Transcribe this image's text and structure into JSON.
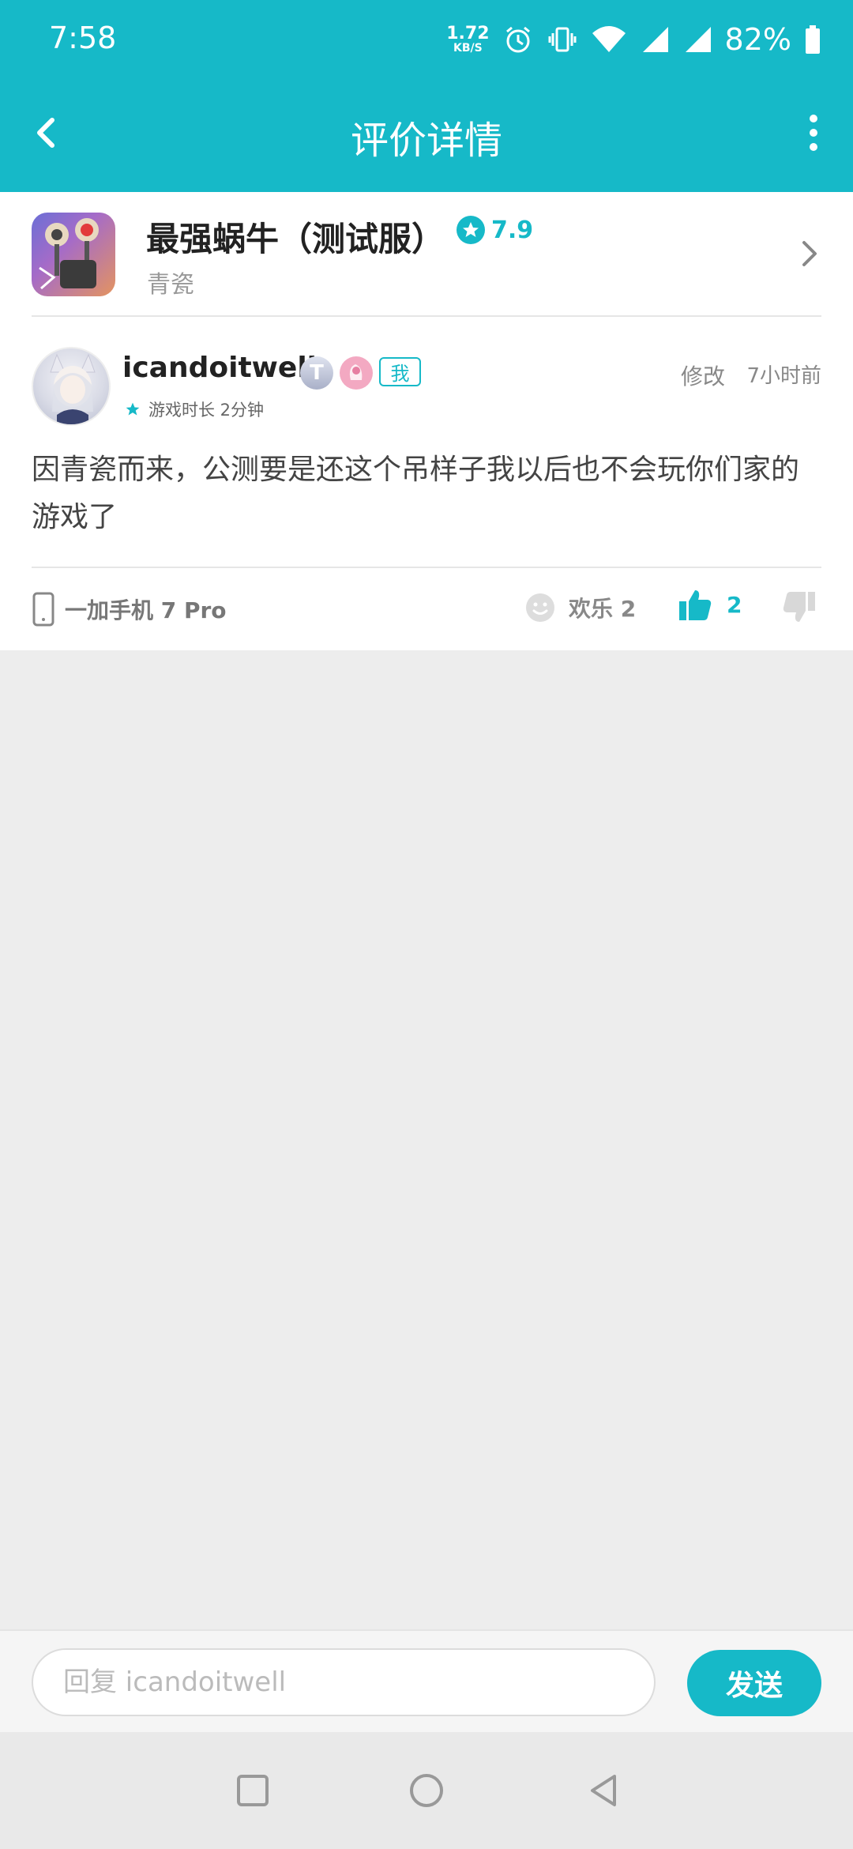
{
  "status_bar": {
    "time": "7:58",
    "net_speed_value": "1.72",
    "net_speed_unit": "KB/S",
    "battery_percent": "82%"
  },
  "header": {
    "title": "评价详情",
    "back_icon": "chevron-left-icon",
    "more_icon": "more-vertical-icon"
  },
  "game": {
    "title": "最强蜗牛（测试服）",
    "subtitle": "青瓷",
    "rating": "7.9"
  },
  "review": {
    "username": "icandoitwell",
    "badge_t": "T",
    "me_label": "我",
    "playtime": "游戏时长 2分钟",
    "edit_label": "修改",
    "time_ago": "7小时前",
    "text": "因青瓷而来，公测要是还这个吊样子我以后也不会玩你们家的游戏了",
    "device": "一加手机 7 Pro",
    "joy_label": "欢乐 2",
    "like_count": "2"
  },
  "reply": {
    "placeholder": "回复 icandoitwell",
    "send_label": "发送"
  },
  "colors": {
    "accent": "#16b9c8",
    "background": "#ededed"
  }
}
